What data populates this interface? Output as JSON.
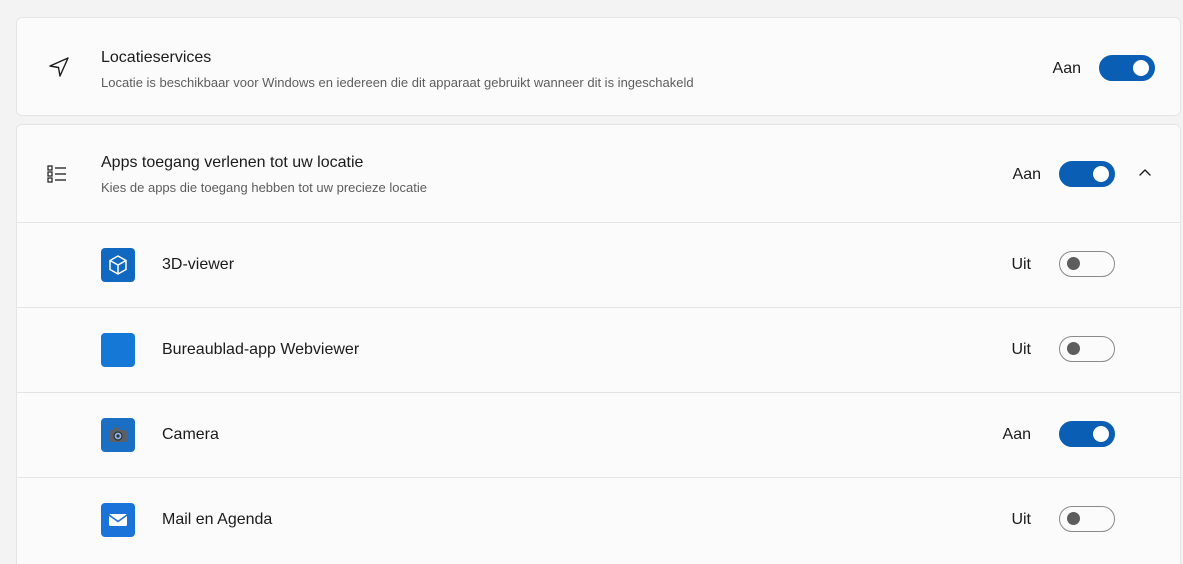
{
  "location_services": {
    "icon": "navigation-arrow-icon",
    "title": "Locatieservices",
    "subtitle": "Locatie is beschikbaar voor Windows en iedereen die dit apparaat gebruikt wanneer dit is ingeschakeld",
    "state_label": "Aan",
    "enabled": true
  },
  "app_access": {
    "icon": "bulleted-list-icon",
    "title": "Apps toegang verlenen tot uw locatie",
    "subtitle": "Kies de apps die toegang hebben tot uw precieze locatie",
    "state_label": "Aan",
    "enabled": true,
    "expanded": true,
    "chevron_icon": "chevron-up-icon"
  },
  "apps": [
    {
      "name": "3D-viewer",
      "icon": "3d-cube-icon",
      "state_label": "Uit",
      "enabled": false
    },
    {
      "name": "Bureaublad-app Webviewer",
      "icon": "blue-square-icon",
      "state_label": "Uit",
      "enabled": false
    },
    {
      "name": "Camera",
      "icon": "camera-icon",
      "state_label": "Aan",
      "enabled": true
    },
    {
      "name": "Mail en Agenda",
      "icon": "mail-icon",
      "state_label": "Uit",
      "enabled": false
    }
  ],
  "colors": {
    "accent": "#0a5fb4",
    "card_background": "#fbfbfb",
    "page_background": "#f3f3f3",
    "app_tile_blue": "#0f6cbd"
  }
}
